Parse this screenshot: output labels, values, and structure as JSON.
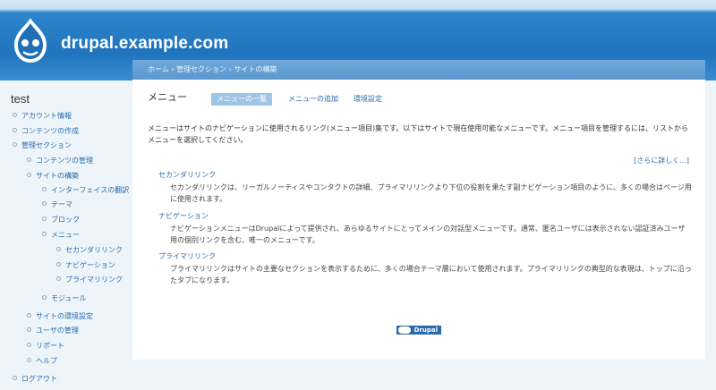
{
  "header": {
    "site_name": "drupal.example.com"
  },
  "sidebar": {
    "title": "test",
    "items": [
      {
        "label": "アカウント情報"
      },
      {
        "label": "コンテンツの作成"
      },
      {
        "label": "管理セクション"
      },
      {
        "label": "コンテンツの管理"
      },
      {
        "label": "サイトの構築"
      },
      {
        "label": "インターフェイスの翻訳"
      },
      {
        "label": "テーマ"
      },
      {
        "label": "ブロック"
      },
      {
        "label": "メニュー"
      },
      {
        "label": "セカンダリリンク"
      },
      {
        "label": "ナビゲーション"
      },
      {
        "label": "プライマリリンク"
      },
      {
        "label": "モジュール"
      },
      {
        "label": "サイトの環境設定"
      },
      {
        "label": "ユーザの管理"
      },
      {
        "label": "リポート"
      },
      {
        "label": "ヘルプ"
      },
      {
        "label": "ログアウト"
      }
    ]
  },
  "breadcrumb": {
    "items": [
      "ホーム",
      "管理セクション",
      "サイトの構築"
    ],
    "separator": "›"
  },
  "main": {
    "title": "メニュー",
    "tabs": [
      {
        "label": "メニューの一覧",
        "active": true
      },
      {
        "label": "メニューの追加",
        "active": false
      },
      {
        "label": "環境設定",
        "active": false
      }
    ],
    "intro": "メニューはサイトのナビゲーションに使用されるリンク(メニュー項目)集です。以下はサイトで現在使用可能なメニューです。メニュー項目を管理するには、リストからメニューを選択してください。",
    "more_link": "[さらに詳しく...]",
    "menus": [
      {
        "name": "セカンダリリンク",
        "description": "セカンダリリンクは、リーガルノーティスやコンタクトの詳細、プライマリリンクより下位の役割を果たす副ナビゲーション項目のように、多くの場合はページ用に使用されます。"
      },
      {
        "name": "ナビゲーション",
        "description": "ナビゲーションメニューはDrupalによって提供され、あらゆるサイトにとってメインの対話型メニューです。通常、匿名ユーザには表示されない認証済みユーザ用の個別リンクを含む、唯一のメニューです。"
      },
      {
        "name": "プライマリリンク",
        "description": "プライマリリンクはサイトの主要なセクションを表示するために、多くの場合テーマ層において使用されます。プライマリリンクの典型的な表現は、トップに沿ったタブになります。"
      }
    ]
  },
  "footer": {
    "powered_by": "Drupal"
  },
  "colors": {
    "header_blue": "#1f74bd",
    "link": "#2a6aaa",
    "active_tab": "#9ec4e6",
    "breadcrumb_bar": "#6fa8da"
  }
}
